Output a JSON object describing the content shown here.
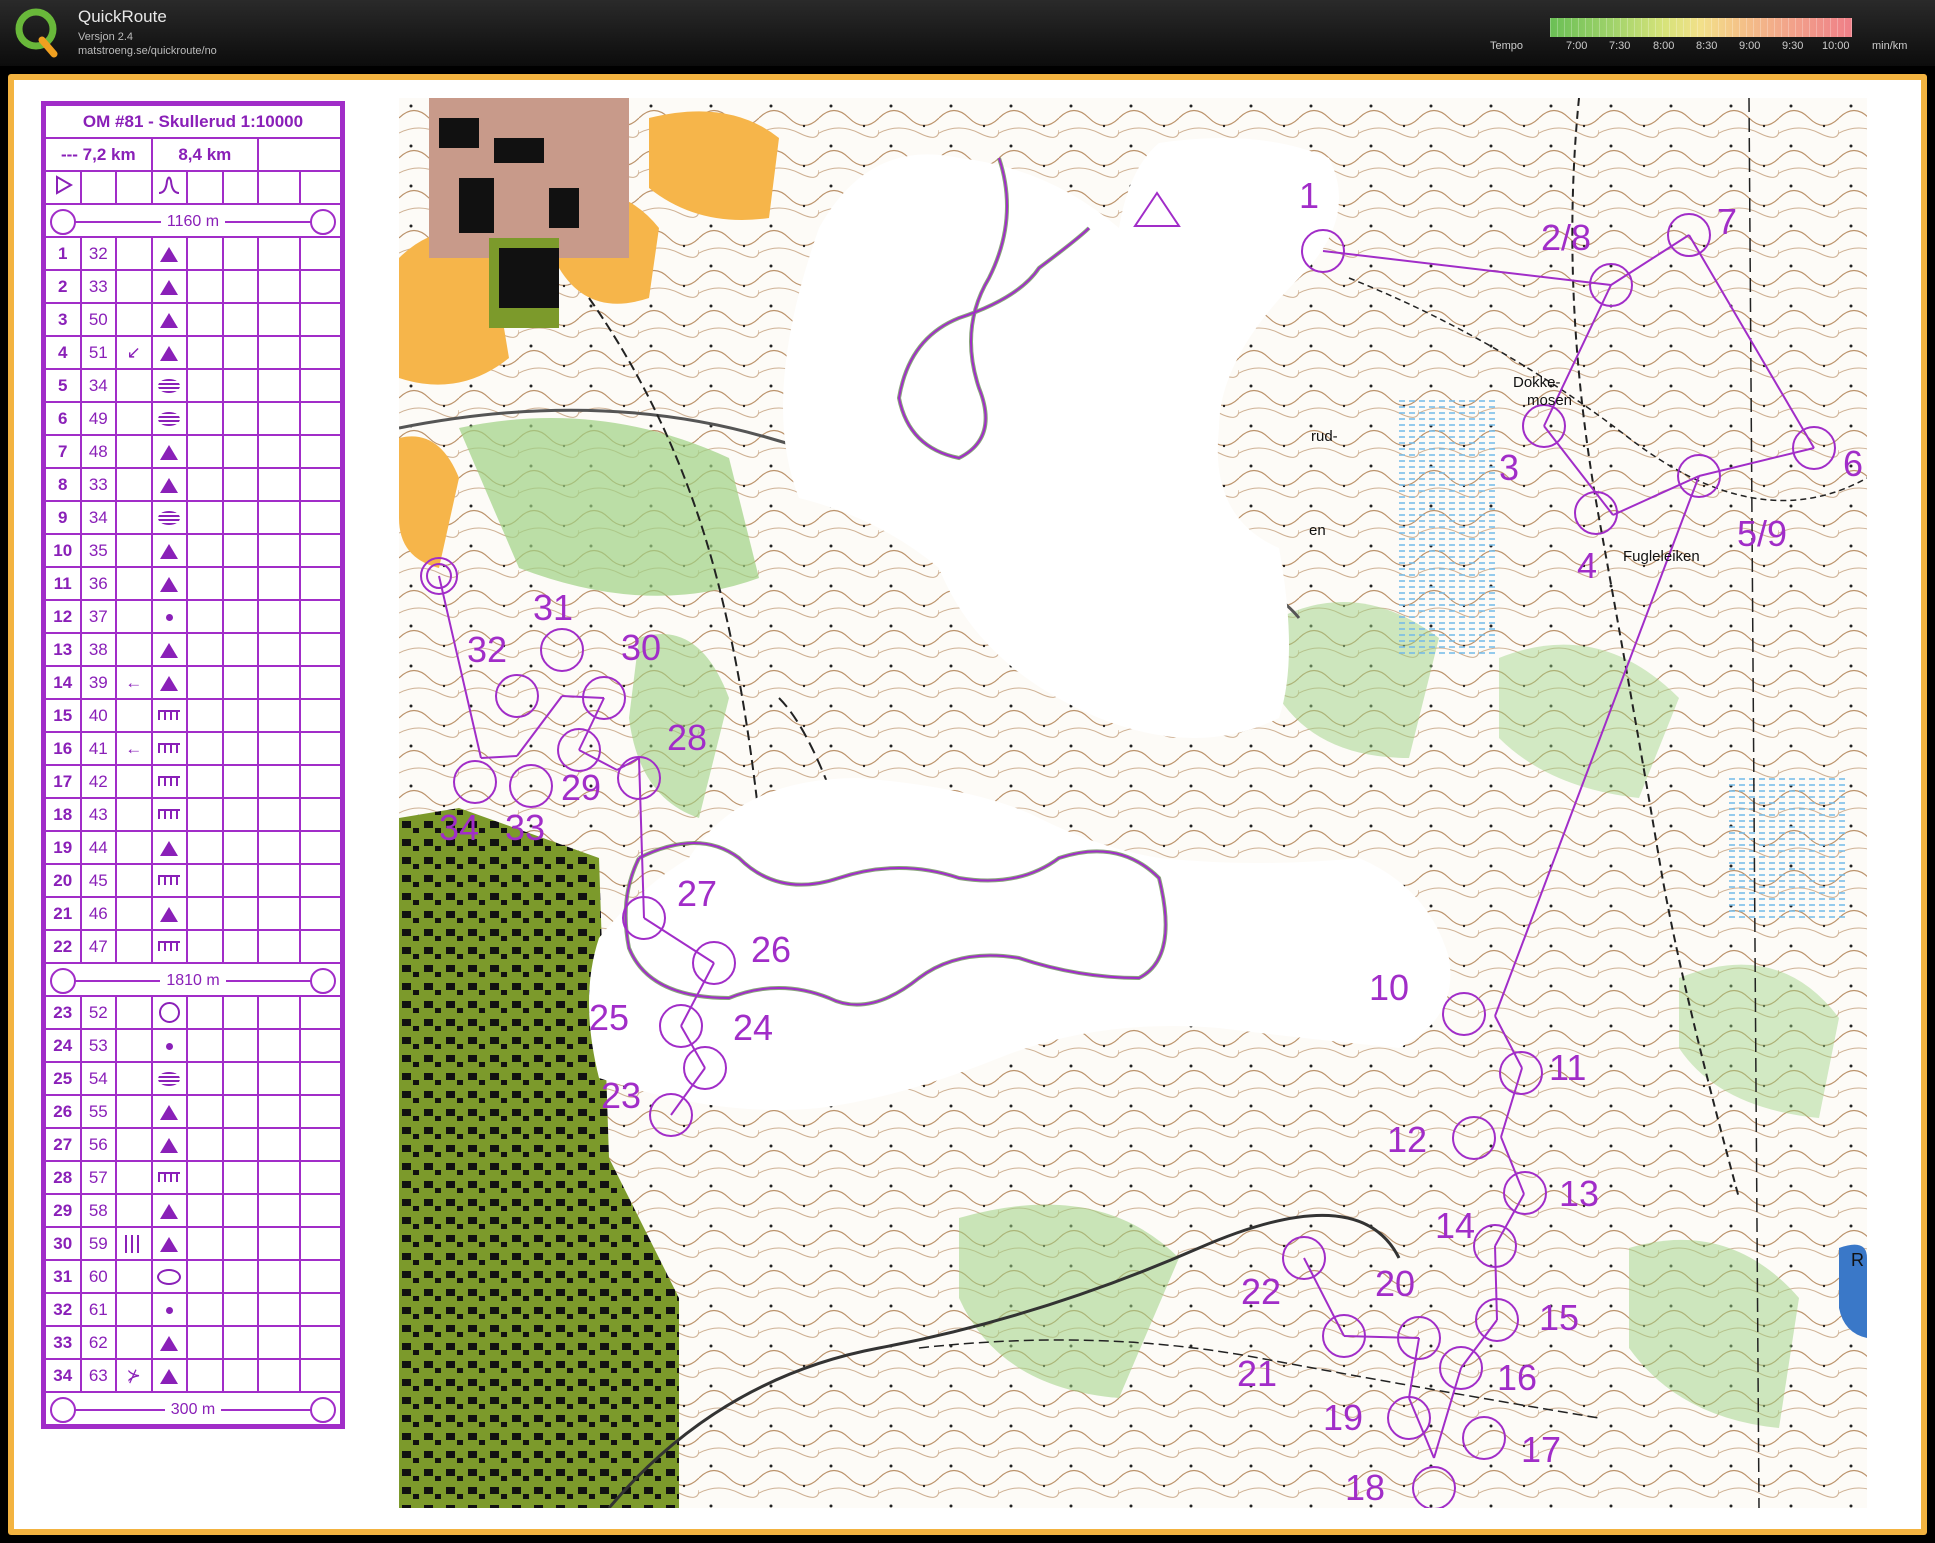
{
  "app": {
    "name": "QuickRoute",
    "version": "Versjon 2.4",
    "url": "matstroeng.se/quickroute/no"
  },
  "tempo": {
    "label": "Tempo",
    "ticks": [
      "7:00",
      "7:30",
      "8:00",
      "8:30",
      "9:00",
      "9:30",
      "10:00"
    ],
    "unit": "min/km",
    "colors": [
      "#6abf55",
      "#d7e37a",
      "#f4c488",
      "#ef7f88"
    ]
  },
  "sheet": {
    "title": "OM #81 - Skullerud 1:10000",
    "course_dash": "--- 7,2 km",
    "course_length": "8,4 km",
    "leg_1": "1160 m",
    "leg_2": "1810 m",
    "leg_3": "300 m",
    "controls": [
      {
        "n": "1",
        "code": "32",
        "dir": "",
        "sym": "tri"
      },
      {
        "n": "2",
        "code": "33",
        "dir": "",
        "sym": "tri"
      },
      {
        "n": "3",
        "code": "50",
        "dir": "",
        "sym": "tri"
      },
      {
        "n": "4",
        "code": "51",
        "dir": "↙",
        "sym": "tri"
      },
      {
        "n": "5",
        "code": "34",
        "dir": "",
        "sym": "lines"
      },
      {
        "n": "6",
        "code": "49",
        "dir": "",
        "sym": "lines"
      },
      {
        "n": "7",
        "code": "48",
        "dir": "",
        "sym": "tri"
      },
      {
        "n": "8",
        "code": "33",
        "dir": "",
        "sym": "tri"
      },
      {
        "n": "9",
        "code": "34",
        "dir": "",
        "sym": "lines"
      },
      {
        "n": "10",
        "code": "35",
        "dir": "",
        "sym": "tri"
      },
      {
        "n": "11",
        "code": "36",
        "dir": "",
        "sym": "tri"
      },
      {
        "n": "12",
        "code": "37",
        "dir": "",
        "sym": "dot"
      },
      {
        "n": "13",
        "code": "38",
        "dir": "",
        "sym": "tri"
      },
      {
        "n": "14",
        "code": "39",
        "dir": "←",
        "sym": "tri"
      },
      {
        "n": "15",
        "code": "40",
        "dir": "",
        "sym": "comb"
      },
      {
        "n": "16",
        "code": "41",
        "dir": "←",
        "sym": "comb"
      },
      {
        "n": "17",
        "code": "42",
        "dir": "",
        "sym": "comb"
      },
      {
        "n": "18",
        "code": "43",
        "dir": "",
        "sym": "comb"
      },
      {
        "n": "19",
        "code": "44",
        "dir": "",
        "sym": "tri"
      },
      {
        "n": "20",
        "code": "45",
        "dir": "",
        "sym": "comb"
      },
      {
        "n": "21",
        "code": "46",
        "dir": "",
        "sym": "tri"
      },
      {
        "n": "22",
        "code": "47",
        "dir": "",
        "sym": "comb"
      }
    ],
    "controls_b": [
      {
        "n": "23",
        "code": "52",
        "dir": "",
        "sym": "circ"
      },
      {
        "n": "24",
        "code": "53",
        "dir": "",
        "sym": "dot"
      },
      {
        "n": "25",
        "code": "54",
        "dir": "",
        "sym": "lines"
      },
      {
        "n": "26",
        "code": "55",
        "dir": "",
        "sym": "tri"
      },
      {
        "n": "27",
        "code": "56",
        "dir": "",
        "sym": "tri"
      },
      {
        "n": "28",
        "code": "57",
        "dir": "",
        "sym": "comb"
      },
      {
        "n": "29",
        "code": "58",
        "dir": "",
        "sym": "tri"
      },
      {
        "n": "30",
        "code": "59",
        "dir": "bars",
        "sym": "tri"
      },
      {
        "n": "31",
        "code": "60",
        "dir": "",
        "sym": "oval"
      },
      {
        "n": "32",
        "code": "61",
        "dir": "",
        "sym": "dot"
      },
      {
        "n": "33",
        "code": "62",
        "dir": "",
        "sym": "tri"
      },
      {
        "n": "34",
        "code": "63",
        "dir": "⊁",
        "sym": "tri"
      }
    ]
  },
  "map": {
    "labels": {
      "c1": "1",
      "c28b": "2/8",
      "c7": "7",
      "c3": "3",
      "c4": "4",
      "c59": "5/9",
      "c6": "6",
      "c10": "10",
      "c11": "11",
      "c12": "12",
      "c13": "13",
      "c14": "14",
      "c15": "15",
      "c16": "16",
      "c17": "17",
      "c18": "18",
      "c19": "19",
      "c20": "20",
      "c21": "21",
      "c22": "22",
      "c23": "23",
      "c24": "24",
      "c25": "25",
      "c26": "26",
      "c27": "27",
      "c28": "28",
      "c29": "29",
      "c30": "30",
      "c31": "31",
      "c32": "32",
      "c33": "33",
      "c34": "34"
    },
    "place_names": {
      "dokke1": "Dokke-",
      "dokke2": "mosen",
      "fugle": "Fugleleiken",
      "rud": "rud-",
      "en": "en",
      "r": "R"
    },
    "colors": {
      "course": "#a12dc8",
      "forest_green": "#9ed283",
      "open_yellow": "#f6b54a",
      "urban_olive": "#7c9a2b",
      "contour_brown": "#a0652f",
      "water_blue": "#71b9e8"
    }
  }
}
